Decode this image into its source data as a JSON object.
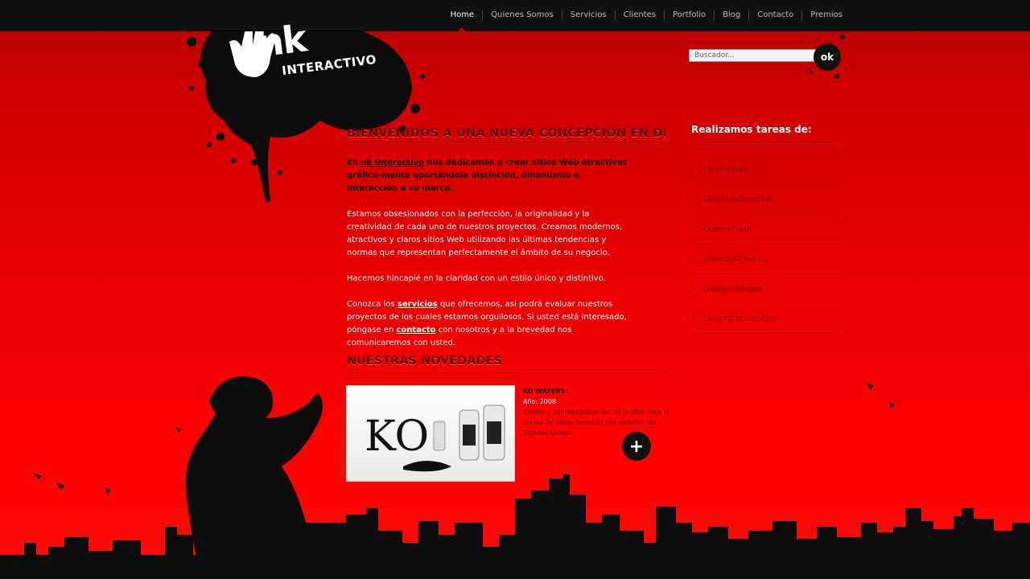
{
  "nav": {
    "items": [
      "Home",
      "Quienes Somos",
      "Servicios",
      "Clientes",
      "Portfolio",
      "Blog",
      "Contacto",
      "Premios"
    ],
    "active": "Home"
  },
  "logo": {
    "main": "nk",
    "sub": "INTERACTIVO"
  },
  "search": {
    "placeholder": "Buscador...",
    "button": "ok"
  },
  "main": {
    "title": "BIENVENIDOS A UNA NUEVA CONCEPCION EN DISEÑO:",
    "intro_prefix": "En ",
    "intro_link": "nk interactivo",
    "intro_rest": " nos dedicamos a crear sitios Web atractivos gráfica-mente aportándole distinción, dinamismo e interacción a su marca.",
    "p1": "Estamos obsesionados con la perfección, la originalidad y la creatividad de cada uno de nuestros proyectos. Creamos modernos, atractivos y claros sitios Web utilizando las últimas tendencias y normas que representan perfectamente el ámbito de su negocio.",
    "p2": "Hacemos hincapié en la claridad con un estilo único y distintivo.",
    "p3_a": "Conozca los ",
    "p3_link1": "servicios",
    "p3_b": " que ofrecemos, así podrá evaluar nuestros proyectos de los cuales estamos orgullosos. Si usted está interesado, póngase en ",
    "p3_link2": "contacto",
    "p3_c": " con nosotros y a la brevedad nos comunicaremos con usted."
  },
  "news": {
    "title": "NUESTRAS NOVEDADES",
    "item_title": "KO WATERS:",
    "item_year": "Año: 2008",
    "item_desc": "Diseño y conceptualización de la idea para la marca de aguas exóticas con sede en los Estados Unidos.",
    "image_text": "KO",
    "more_button": "+"
  },
  "sidebar": {
    "title": "Realizamos tareas de:",
    "items": [
      "Diseño Web",
      "Diseño Interactivo",
      "Diseño Flash",
      "Diseño de Marca",
      "Diseño Impreso",
      "Desarrollo de Sitios"
    ]
  },
  "colors": {
    "accent": "#e60000",
    "dark": "#111111"
  }
}
